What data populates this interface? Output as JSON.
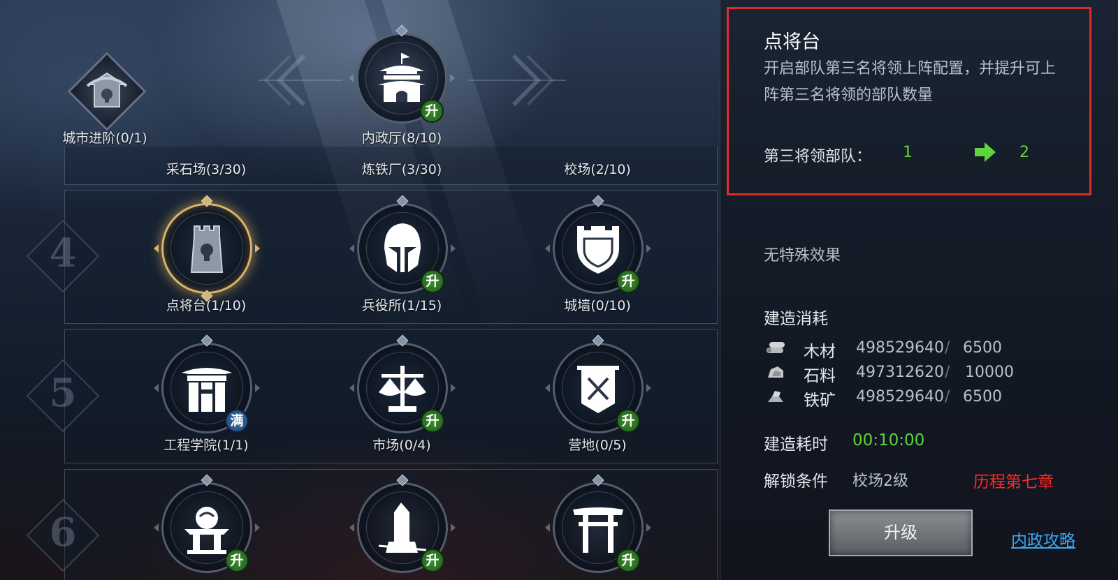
{
  "tree": {
    "top_row": [
      {
        "label": "城市进阶(0/1)",
        "icon": "locked-pavilion-icon"
      },
      {
        "label": "内政厅(8/10)",
        "icon": "palace-icon",
        "badge": "升"
      }
    ],
    "partial_row": [
      {
        "label": "采石场(3/30)"
      },
      {
        "label": "炼铁厂(3/30)"
      },
      {
        "label": "校场(2/10)"
      }
    ],
    "rows": [
      {
        "level": "4",
        "nodes": [
          {
            "label": "点将台(1/10)",
            "icon": "locked-tower-icon",
            "badge": "",
            "selected": true
          },
          {
            "label": "兵役所(1/15)",
            "icon": "helmet-icon",
            "badge": "升"
          },
          {
            "label": "城墙(0/10)",
            "icon": "wall-shield-icon",
            "badge": "升"
          }
        ]
      },
      {
        "level": "5",
        "nodes": [
          {
            "label": "工程学院(1/1)",
            "icon": "gate-icon",
            "badge": "满"
          },
          {
            "label": "市场(0/4)",
            "icon": "scales-icon",
            "badge": "升"
          },
          {
            "label": "营地(0/5)",
            "icon": "banner-swords-icon",
            "badge": "升"
          }
        ]
      },
      {
        "level": "6",
        "nodes": [
          {
            "label": "",
            "icon": "altar-icon",
            "badge": "升"
          },
          {
            "label": "",
            "icon": "monument-icon",
            "badge": "升"
          },
          {
            "label": "",
            "icon": "torii-gate-icon",
            "badge": "升"
          }
        ]
      }
    ]
  },
  "info": {
    "title": "点将台",
    "description_line1": "开启部队第三名将领上阵配置，并提升可上",
    "description_line2": "阵第三名将领的部队数量",
    "stat_label": "第三将领部队：",
    "stat_from": "1",
    "stat_to": "2",
    "no_effect": "无特殊效果",
    "cost_title": "建造消耗",
    "costs": [
      {
        "name": "木材",
        "have": "498529640",
        "sep": "/",
        "need": "6500",
        "icon": "wood-icon"
      },
      {
        "name": "石料",
        "have": "497312620",
        "sep": "/",
        "need": "10000",
        "icon": "stone-icon"
      },
      {
        "name": "铁矿",
        "have": "498529640",
        "sep": "/",
        "need": "6500",
        "icon": "iron-ore-icon"
      }
    ],
    "time_label": "建造耗时",
    "time_value": "00:10:00",
    "unlock_label": "解锁条件",
    "unlock_req1": "校场2级",
    "unlock_req2": "历程第七章",
    "upgrade_button": "升级",
    "guide_link": "内政攻略"
  },
  "colors": {
    "highlight_border": "#e12a2a",
    "green_value": "#5fd53c",
    "red_text": "#ff2a2a",
    "link": "#3aa9f0",
    "badge_upgrade": "#2f7a28",
    "badge_full": "#2a5d90",
    "selected_ring": "#d9b46a"
  }
}
